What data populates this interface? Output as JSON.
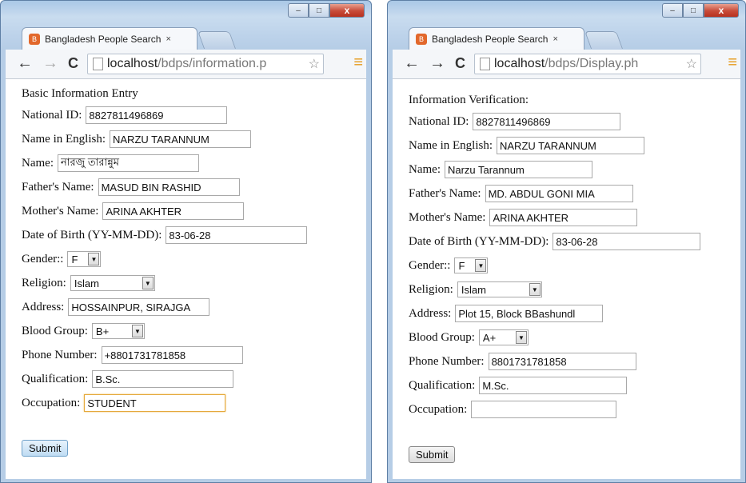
{
  "left": {
    "tab_title": "Bangladesh People Search",
    "tab_close": "×",
    "url_host": "localhost",
    "url_path": "/bdps/information.p",
    "heading": "Basic Information Entry",
    "fields": {
      "national_id": {
        "label": "National ID:",
        "value": "8827811496869"
      },
      "name_english": {
        "label": "Name in English:",
        "value": "NARZU TARANNUM"
      },
      "name": {
        "label": "Name:",
        "value": "নারজু তারান্নুম"
      },
      "father": {
        "label": "Father's Name:",
        "value": "MASUD BIN RASHID"
      },
      "mother": {
        "label": "Mother's Name:",
        "value": "ARINA AKHTER"
      },
      "dob": {
        "label": "Date of Birth (YY-MM-DD):",
        "value": "83-06-28"
      },
      "gender": {
        "label": "Gender::",
        "value": "F"
      },
      "religion": {
        "label": "Religion:",
        "value": "Islam"
      },
      "address": {
        "label": "Address:",
        "value": "HOSSAINPUR, SIRAJGA"
      },
      "blood": {
        "label": "Blood Group:",
        "value": "B+"
      },
      "phone": {
        "label": "Phone Number:",
        "value": "+8801731781858"
      },
      "qualification": {
        "label": "Qualification:",
        "value": "B.Sc."
      },
      "occupation": {
        "label": "Occupation:",
        "value": "STUDENT"
      }
    },
    "submit": "Submit"
  },
  "right": {
    "tab_title": "Bangladesh People Search",
    "tab_close": "×",
    "url_host": "localhost",
    "url_path": "/bdps/Display.ph",
    "heading": "Information Verification:",
    "fields": {
      "national_id": {
        "label": "National ID:",
        "value": "8827811496869"
      },
      "name_english": {
        "label": "Name in English:",
        "value": "NARZU TARANNUM"
      },
      "name": {
        "label": "Name:",
        "value": "Narzu Tarannum"
      },
      "father": {
        "label": "Father's Name:",
        "value": "MD. ABDUL GONI MIA"
      },
      "mother": {
        "label": "Mother's Name:",
        "value": "ARINA AKHTER"
      },
      "dob": {
        "label": "Date of Birth (YY-MM-DD):",
        "value": "83-06-28"
      },
      "gender": {
        "label": "Gender::",
        "value": "F"
      },
      "religion": {
        "label": "Religion:",
        "value": "Islam"
      },
      "address": {
        "label": "Address:",
        "value": "Plot 15, Block BBashundl"
      },
      "blood": {
        "label": "Blood Group:",
        "value": "A+"
      },
      "phone": {
        "label": "Phone Number:",
        "value": "8801731781858"
      },
      "qualification": {
        "label": "Qualification:",
        "value": "M.Sc."
      },
      "occupation": {
        "label": "Occupation:",
        "value": ""
      }
    },
    "submit": "Submit"
  },
  "icons": {
    "back": "←",
    "forward": "→",
    "reload": "C",
    "star": "☆",
    "menu": "≡",
    "minimize": "–",
    "maximize": "□",
    "close": "x",
    "dropdown": "▼",
    "favicon": "B"
  },
  "colors": {
    "accent": "#e59a1a",
    "focus_border": "#e5a93b",
    "favicon": "#e2682c"
  }
}
